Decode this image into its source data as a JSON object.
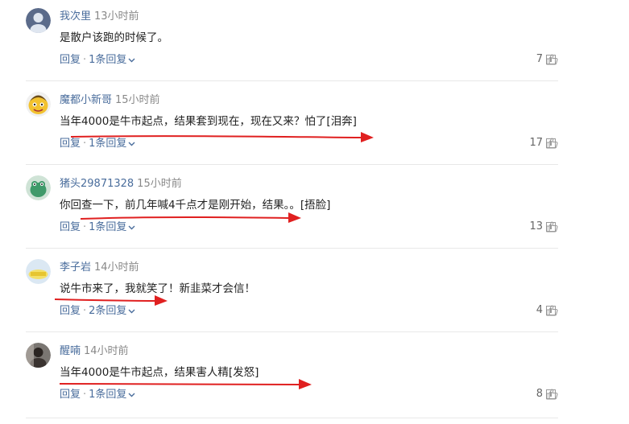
{
  "comments": [
    {
      "username": "我次里",
      "time": "13小时前",
      "content": "是散户该跑的时候了。",
      "reply_label": "回复",
      "sep": "·",
      "replies_label": "1条回复",
      "likes": "7",
      "avatar_icon": "blue-circle-avatar"
    },
    {
      "username": "魔都小新哥",
      "time": "15小时前",
      "content": "当年4000是牛市起点，结果套到现在，现在又来？怕了[泪奔]",
      "reply_label": "回复",
      "sep": "·",
      "replies_label": "1条回复",
      "likes": "17",
      "avatar_icon": "cartoon-face-avatar"
    },
    {
      "username": "猪头29871328",
      "time": "15小时前",
      "content": "你回查一下，前几年喊4千点才是刚开始，结果。。[捂脸]",
      "reply_label": "回复",
      "sep": "·",
      "replies_label": "1条回复",
      "likes": "13",
      "avatar_icon": "green-frog-avatar"
    },
    {
      "username": "李子岩",
      "time": "14小时前",
      "content": "说牛市来了，我就笑了！新韭菜才会信！",
      "reply_label": "回复",
      "sep": "·",
      "replies_label": "2条回复",
      "likes": "4",
      "avatar_icon": "yellow-text-avatar"
    },
    {
      "username": "醒喃",
      "time": "14小时前",
      "content": "当年4000是牛市起点，结果害人精[发怒]",
      "reply_label": "回复",
      "sep": "·",
      "replies_label": "1条回复",
      "likes": "8",
      "avatar_icon": "photo-avatar"
    }
  ],
  "colors": {
    "username": "#4a6d9c",
    "link": "#4a6d9c",
    "arrow": "#e02020",
    "divider": "#e8e8e8"
  }
}
